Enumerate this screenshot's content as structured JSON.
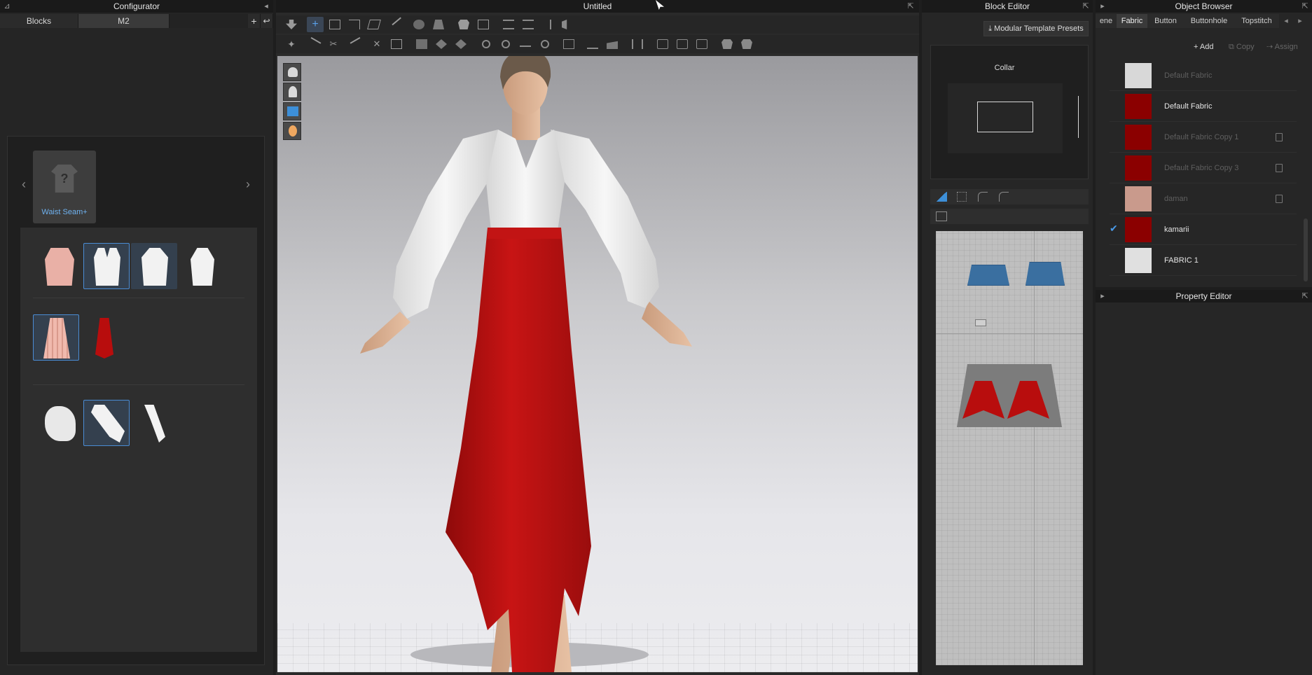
{
  "configurator": {
    "title": "Configurator",
    "tabs": [
      {
        "label": "Blocks"
      },
      {
        "label": "M2"
      }
    ],
    "group_label": "Waist Seam+",
    "rows": [
      {
        "items": [
          "peplum top",
          "fitted top",
          "bodice front",
          "sleeveless top"
        ],
        "selected": [
          1,
          2
        ]
      },
      {
        "items": [
          "pleated skirt",
          "red skirt"
        ],
        "selected": [
          0
        ]
      },
      {
        "items": [
          "puff sleeve",
          "bishop sleeve",
          "straight sleeve"
        ],
        "selected": [
          1
        ]
      }
    ]
  },
  "viewport": {
    "title": "Untitled",
    "side_tools": [
      "avatar-visibility-icon",
      "garment-visibility-icon",
      "fabric-render-icon",
      "skin-icon"
    ]
  },
  "block_editor": {
    "title": "Block Editor",
    "presets_button": "Modular Template Presets",
    "collar_label": "Collar"
  },
  "object_browser": {
    "title": "Object Browser",
    "tabs": [
      {
        "label": "ene"
      },
      {
        "label": "Fabric"
      },
      {
        "label": "Button"
      },
      {
        "label": "Buttonhole"
      },
      {
        "label": "Topstitch"
      }
    ],
    "add_label": "Add",
    "copy_label": "Copy",
    "assign_label": "Assign",
    "fabrics": [
      {
        "name": "Default Fabric",
        "color": "#d8d8d8",
        "dim": true,
        "delete": false,
        "checked": false
      },
      {
        "name": "Default Fabric",
        "color": "#8b0000",
        "dim": false,
        "delete": false,
        "checked": false
      },
      {
        "name": "Default Fabric Copy 1",
        "color": "#8b0000",
        "dim": true,
        "delete": true,
        "checked": false
      },
      {
        "name": "Default Fabric Copy 3",
        "color": "#8b0000",
        "dim": true,
        "delete": true,
        "checked": false
      },
      {
        "name": "daman",
        "color": "#c99a8c",
        "dim": true,
        "delete": true,
        "checked": false
      },
      {
        "name": "kamarii",
        "color": "#8b0000",
        "dim": false,
        "delete": false,
        "checked": true
      },
      {
        "name": "FABRIC 1",
        "color": "#e0e0e0",
        "dim": false,
        "delete": false,
        "checked": false
      }
    ]
  },
  "property_editor": {
    "title": "Property Editor"
  },
  "colors": {
    "accent": "#4a8cd4",
    "fabric_red": "#b80d0d",
    "panel_bg": "#262626"
  }
}
